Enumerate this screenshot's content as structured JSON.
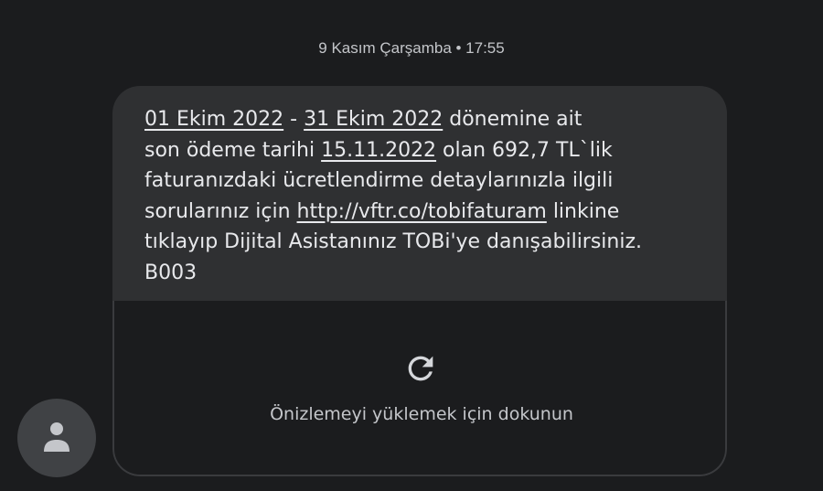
{
  "header": {
    "date": "9 Kasım Çarşamba • 17:55"
  },
  "contact": {
    "avatar_icon": "person-icon"
  },
  "message": {
    "lines": [
      [
        {
          "text": "01 Ekim 2022",
          "link": true
        },
        {
          "text": " - ",
          "link": false
        },
        {
          "text": "31 Ekim 2022",
          "link": true
        },
        {
          "text": " dönemine ait",
          "link": false
        }
      ],
      [
        {
          "text": "son ödeme tarihi ",
          "link": false
        },
        {
          "text": "15.11.2022",
          "link": true
        },
        {
          "text": " olan 692,7 TL`lik",
          "link": false
        }
      ],
      [
        {
          "text": "faturanızdaki ücretlendirme detaylarınızla ilgili",
          "link": false
        }
      ],
      [
        {
          "text": "sorularınız için ",
          "link": false
        },
        {
          "text": "http://vftr.co/tobifaturam",
          "link": true
        },
        {
          "text": " linkine",
          "link": false
        }
      ],
      [
        {
          "text": "tıklayıp Dijital Asistanınız TOBi'ye danışabilirsiniz.",
          "link": false
        }
      ],
      [
        {
          "text": " B003",
          "link": false
        }
      ]
    ]
  },
  "preview": {
    "icon": "refresh-icon",
    "label": "Önizlemeyi yüklemek için dokunun"
  },
  "colors": {
    "background": "#1b1c1e",
    "bubble": "#2f3032",
    "text": "#e8e9ec",
    "muted": "#c4c6ca"
  }
}
